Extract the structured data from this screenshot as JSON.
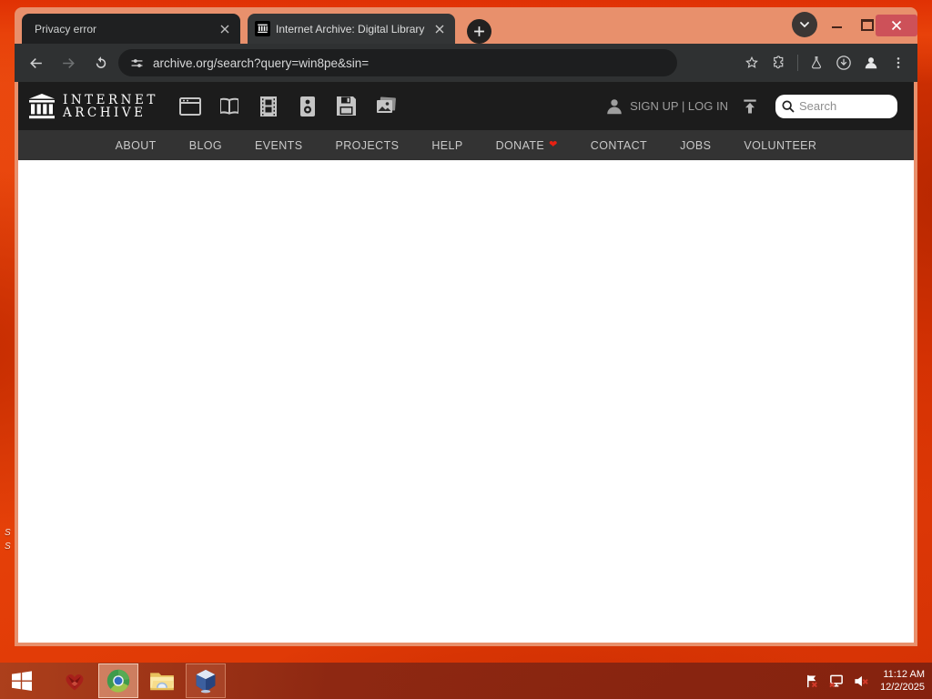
{
  "browser": {
    "tabs": [
      {
        "title": "Privacy error",
        "active": false
      },
      {
        "title": "Internet Archive: Digital Library",
        "active": true
      }
    ],
    "url": "archive.org/search?query=win8pe&sin="
  },
  "ia": {
    "wordmark_line1": "INTERNET",
    "wordmark_line2": "ARCHIVE",
    "auth_text": "SIGN UP | LOG IN",
    "search_placeholder": "Search",
    "nav": {
      "about": "ABOUT",
      "blog": "BLOG",
      "events": "EVENTS",
      "projects": "PROJECTS",
      "help": "HELP",
      "donate": "DONATE",
      "contact": "CONTACT",
      "jobs": "JOBS",
      "volunteer": "VOLUNTEER"
    }
  },
  "taskbar": {
    "time": "11:12 AM",
    "date": "12/2/2025"
  },
  "desktop": {
    "label_fragment_1": "S",
    "label_fragment_2": "S"
  },
  "colors": {
    "accent_orange": "#e8430a",
    "frame_salmon": "#e8906c",
    "close_red": "#cd5159",
    "donate_heart": "#e82012"
  }
}
